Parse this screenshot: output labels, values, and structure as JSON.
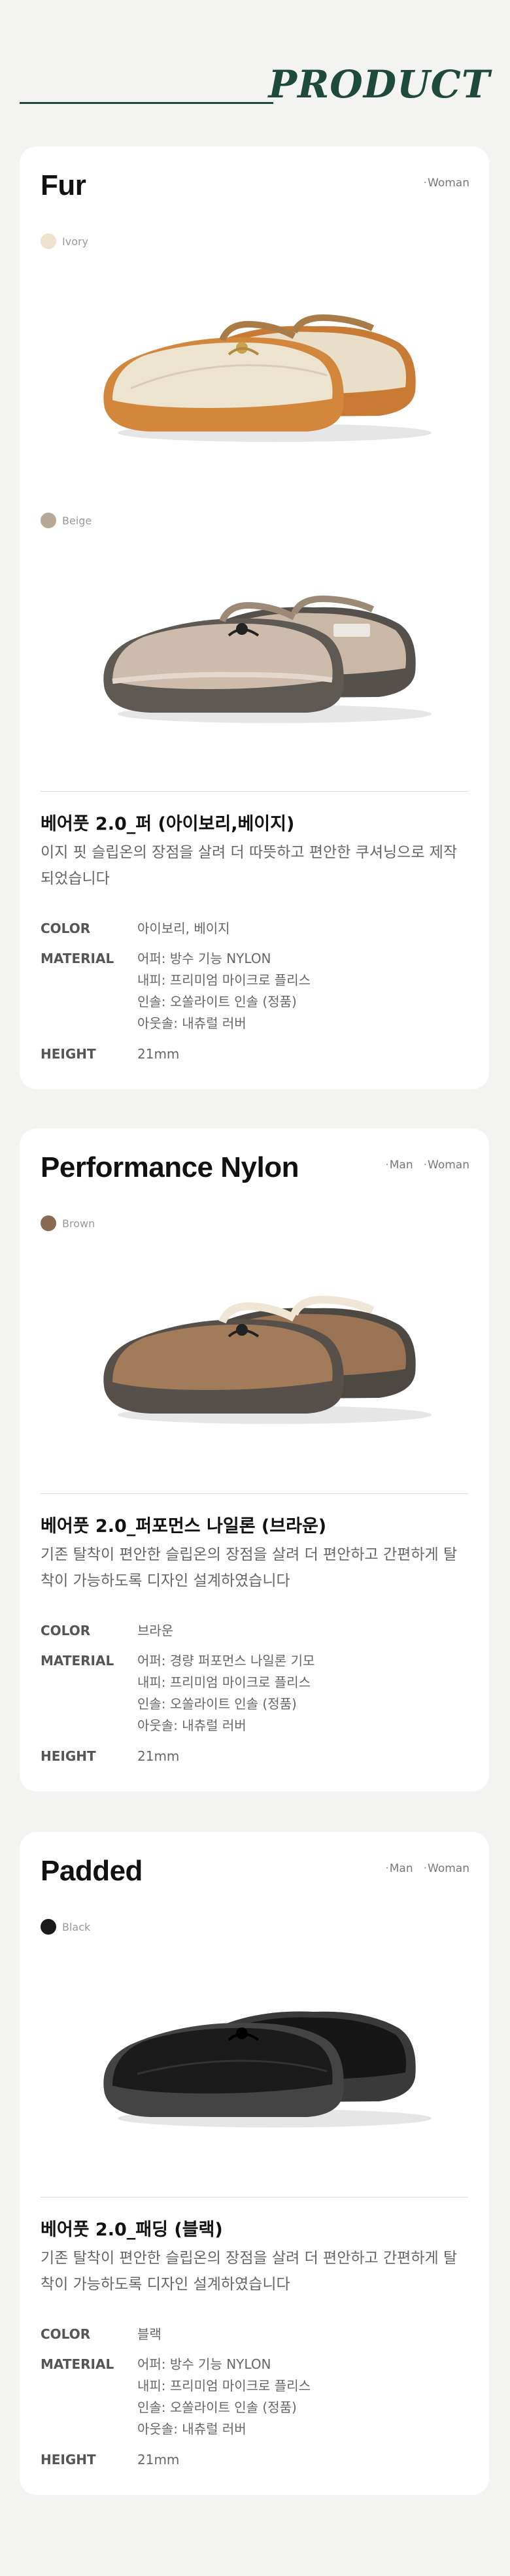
{
  "header": {
    "title": "PRODUCT"
  },
  "products": [
    {
      "title": "Fur",
      "tags": [
        "Woman"
      ],
      "colors": [
        {
          "label": "Ivory",
          "swatch": "#efe2cc"
        },
        {
          "label": "Beige",
          "swatch": "#b8a898"
        }
      ],
      "name": "베어풋 2.0_퍼 (아이보리,베이지)",
      "description": "이지 핏 슬립온의 장점을 살려 더 따뜻하고 편안한 쿠셔닝으로 제작 되었습니다",
      "specs": {
        "color_label": "COLOR",
        "color_value": "아이보리, 베이지",
        "material_label": "MATERIAL",
        "material_lines": [
          "어퍼: 방수 기능 NYLON",
          "내피: 프리미엄 마이크로 플리스",
          "인솔: 오쏠라이트 인솔 (정품)",
          "아웃솔: 내츄럴 러버"
        ],
        "height_label": "HEIGHT",
        "height_value": "21mm"
      }
    },
    {
      "title": "Performance Nylon",
      "tags": [
        "Man",
        "Woman"
      ],
      "colors": [
        {
          "label": "Brown",
          "swatch": "#8a6a52"
        }
      ],
      "name": "베어풋 2.0_퍼포먼스 나일론 (브라운)",
      "description": "기존 탈착이 편안한 슬립온의 장점을 살려 더 편안하고 간편하게 탈착이 가능하도록 디자인 설계하였습니다",
      "specs": {
        "color_label": "COLOR",
        "color_value": "브라운",
        "material_label": "MATERIAL",
        "material_lines": [
          "어퍼: 경량 퍼포먼스 나일론 기모",
          "내피: 프리미엄 마이크로 플리스",
          "인솔: 오쏠라이트 인솔 (정품)",
          "아웃솔: 내츄럴 러버"
        ],
        "height_label": "HEIGHT",
        "height_value": "21mm"
      }
    },
    {
      "title": "Padded",
      "tags": [
        "Man",
        "Woman"
      ],
      "colors": [
        {
          "label": "Black",
          "swatch": "#1a1a1a"
        }
      ],
      "name": "베어풋 2.0_패딩 (블랙)",
      "description": "기존 탈착이 편안한 슬립온의 장점을 살려 더 편안하고 간편하게 탈착이 가능하도록 디자인 설계하였습니다",
      "specs": {
        "color_label": "COLOR",
        "color_value": "블랙",
        "material_label": "MATERIAL",
        "material_lines": [
          "어퍼: 방수 기능 NYLON",
          "내피: 프리미엄 마이크로 플리스",
          "인솔: 오쏠라이트 인솔 (정품)",
          "아웃솔: 내츄럴 러버"
        ],
        "height_label": "HEIGHT",
        "height_value": "21mm"
      }
    }
  ]
}
